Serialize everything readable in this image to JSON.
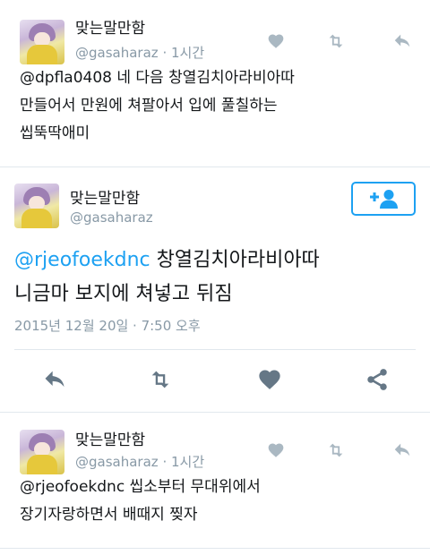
{
  "colors": {
    "accent": "#1da1f2",
    "icon_gray": "#aab8c2",
    "action_gray": "#657786"
  },
  "tweets": [
    {
      "name": "맞는말만함",
      "handle": "@gasaharaz",
      "time": "1시간",
      "lines": [
        "@dpfla0408 네 다음 창열김치아라비아따",
        "만들어서 만원에 쳐팔아서 입에 풀칠하는",
        "씹뚝딱애미"
      ],
      "icons": [
        "heart-icon",
        "retweet-icon",
        "reply-icon"
      ]
    },
    {
      "name": "맞는말만함",
      "handle": "@gasaharaz",
      "mention": "@rjeofoekdnc",
      "line1_rest": " 창열김치아라비아따",
      "line2": "니금마 보지에 쳐넣고 뒤짐",
      "timestamp": "2015년 12월 20일 · 7:50 오후",
      "follow_icon": "add-user-icon",
      "actions": [
        "reply-icon",
        "retweet-icon",
        "heart-icon",
        "share-icon"
      ]
    },
    {
      "name": "맞는말만함",
      "handle": "@gasaharaz",
      "time": "1시간",
      "lines": [
        "@rjeofoekdnc 씹소부터 무대위에서",
        "장기자랑하면서 배때지 찢자"
      ],
      "icons": [
        "heart-icon",
        "retweet-icon",
        "reply-icon"
      ]
    }
  ]
}
